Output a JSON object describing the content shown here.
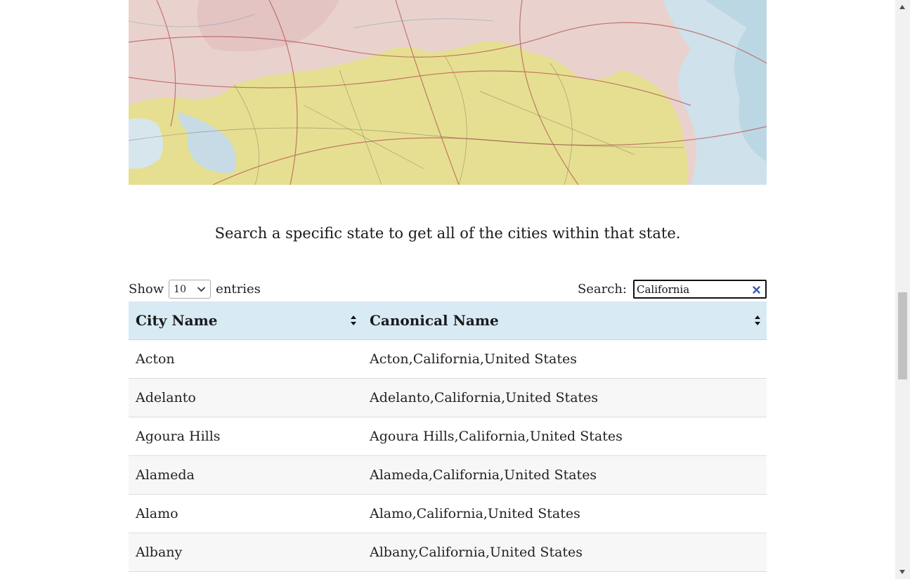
{
  "intro": {
    "text": "Search a specific state to get all of the cities within that state."
  },
  "length": {
    "show_label": "Show",
    "value": "10",
    "entries_label": "entries"
  },
  "search": {
    "label": "Search:",
    "value": "California"
  },
  "table": {
    "headers": [
      "City Name",
      "Canonical Name"
    ],
    "rows": [
      [
        "Acton",
        "Acton,California,United States"
      ],
      [
        "Adelanto",
        "Adelanto,California,United States"
      ],
      [
        "Agoura Hills",
        "Agoura Hills,California,United States"
      ],
      [
        "Alameda",
        "Alameda,California,United States"
      ],
      [
        "Alamo",
        "Alamo,California,United States"
      ],
      [
        "Albany",
        "Albany,California,United States"
      ]
    ]
  },
  "colors": {
    "header_bg": "#d8eaf4",
    "map_pink": "#e9d4d0",
    "map_yellow": "#e8e08f",
    "map_water": "#cfe3ec"
  },
  "icons": [
    "sort-icon",
    "chevron-down-icon",
    "close-icon"
  ]
}
